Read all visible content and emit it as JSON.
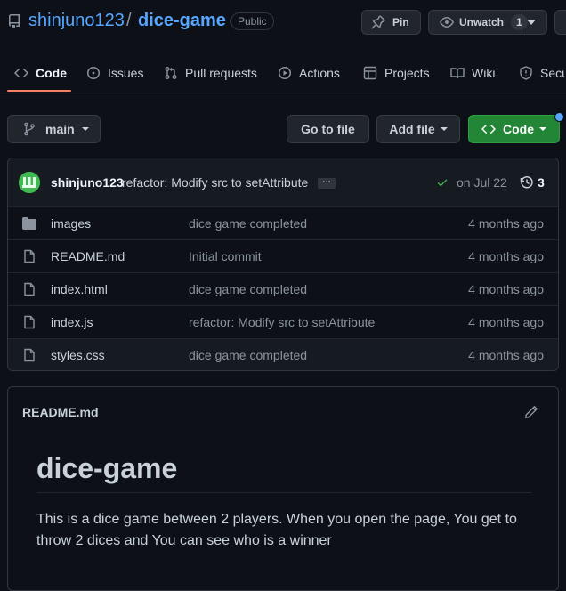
{
  "repo": {
    "owner": "shinjuno123",
    "separator": "/",
    "name": "dice-game",
    "visibility": "Public"
  },
  "header_buttons": {
    "pin_label": "Pin",
    "unwatch_label": "Unwatch",
    "watch_count": "1"
  },
  "tabs": [
    {
      "label": "Code",
      "icon": "code-icon",
      "active": true
    },
    {
      "label": "Issues",
      "icon": "issue-icon"
    },
    {
      "label": "Pull requests",
      "icon": "pull-request-icon"
    },
    {
      "label": "Actions",
      "icon": "play-icon"
    },
    {
      "label": "Projects",
      "icon": "table-icon"
    },
    {
      "label": "Wiki",
      "icon": "book-icon"
    },
    {
      "label": "Secu",
      "icon": "shield-icon"
    }
  ],
  "toolbar": {
    "branch": "main",
    "go_to_file": "Go to file",
    "add_file": "Add file",
    "code": "Code"
  },
  "latest_commit": {
    "author": "shinjuno123",
    "message": "refactor: Modify src to setAttribute",
    "ellipsis": "…",
    "date": "on Jul 22",
    "count": "3"
  },
  "files": [
    {
      "name": "images",
      "type": "folder",
      "message": "dice game completed",
      "age": "4 months ago"
    },
    {
      "name": "README.md",
      "type": "file",
      "message": "Initial commit",
      "age": "4 months ago"
    },
    {
      "name": "index.html",
      "type": "file",
      "message": "dice game completed",
      "age": "4 months ago"
    },
    {
      "name": "index.js",
      "type": "file",
      "message": "refactor: Modify src to setAttribute",
      "age": "4 months ago"
    },
    {
      "name": "styles.css",
      "type": "file",
      "message": "dice game completed",
      "age": "4 months ago"
    }
  ],
  "readme": {
    "filename": "README.md",
    "title": "dice-game",
    "body": "This is a dice game between 2 players. When you open the page, You get to throw 2 dices and You can see who is a winner"
  },
  "colors": {
    "background": "#0d1117",
    "link": "#58a6ff",
    "code_button": "#238636",
    "active_tab_underline": "#f78166",
    "success": "#3fb950"
  }
}
